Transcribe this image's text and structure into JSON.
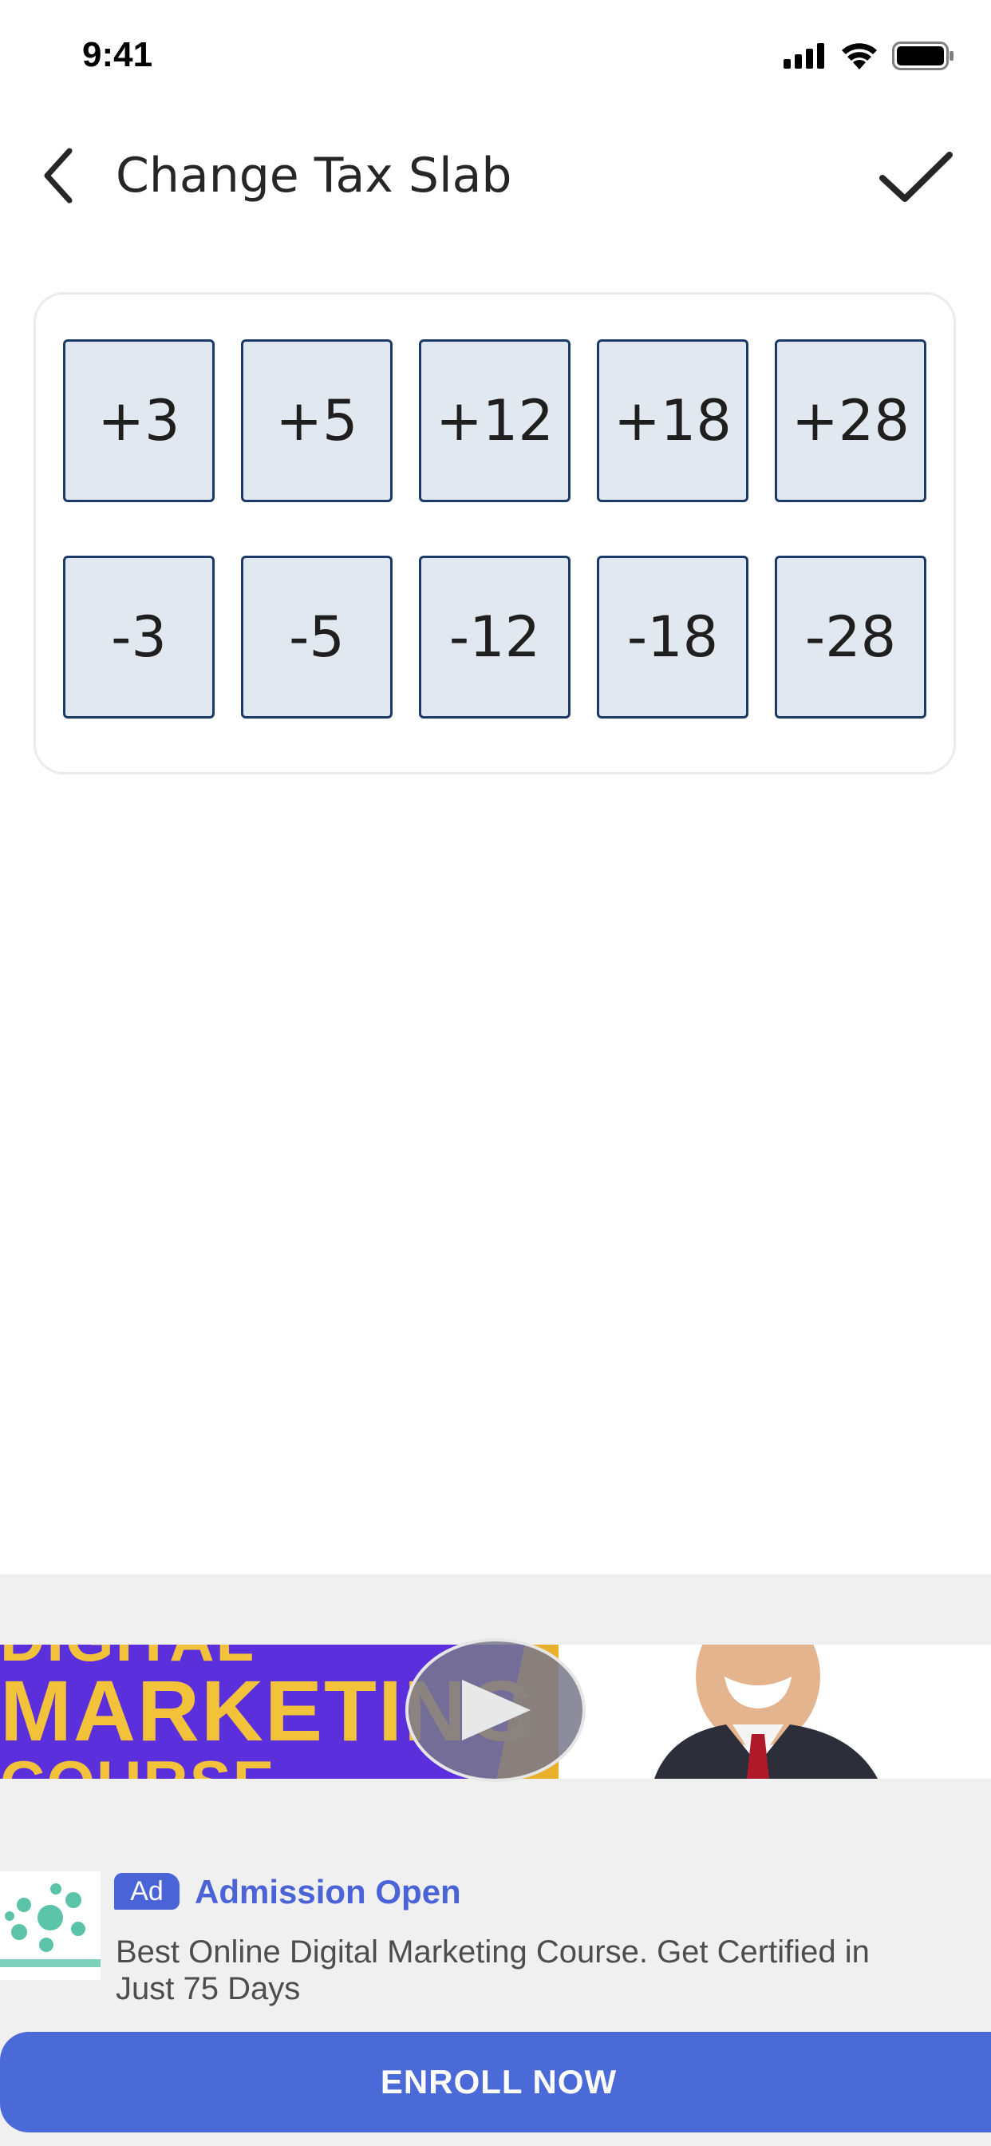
{
  "status_bar": {
    "time": "9:41",
    "icons": [
      "cellular-signal-icon",
      "wifi-icon",
      "battery-icon"
    ]
  },
  "header": {
    "back_icon": "chevron-left-icon",
    "title": "Change Tax Slab",
    "confirm_icon": "checkmark-icon"
  },
  "slabs": {
    "increase": [
      "+3",
      "+5",
      "+12",
      "+18",
      "+28"
    ],
    "decrease": [
      "-3",
      "-5",
      "-12",
      "-18",
      "-28"
    ]
  },
  "ad": {
    "banner": {
      "line1": "DIGITAL",
      "line2": "MARKETING",
      "line3": "COURSE",
      "play_icon": "play-icon"
    },
    "badge": "Ad",
    "headline": "Admission Open",
    "description": "Best Online Digital Marketing Course. Get Certified in Just 75 Days",
    "cta": "ENROLL NOW"
  },
  "colors": {
    "slab_fill": "#e2e8f0",
    "slab_border": "#1c3a68",
    "ad_accent": "#4a64d8",
    "ad_background": "#f0f0f0"
  }
}
